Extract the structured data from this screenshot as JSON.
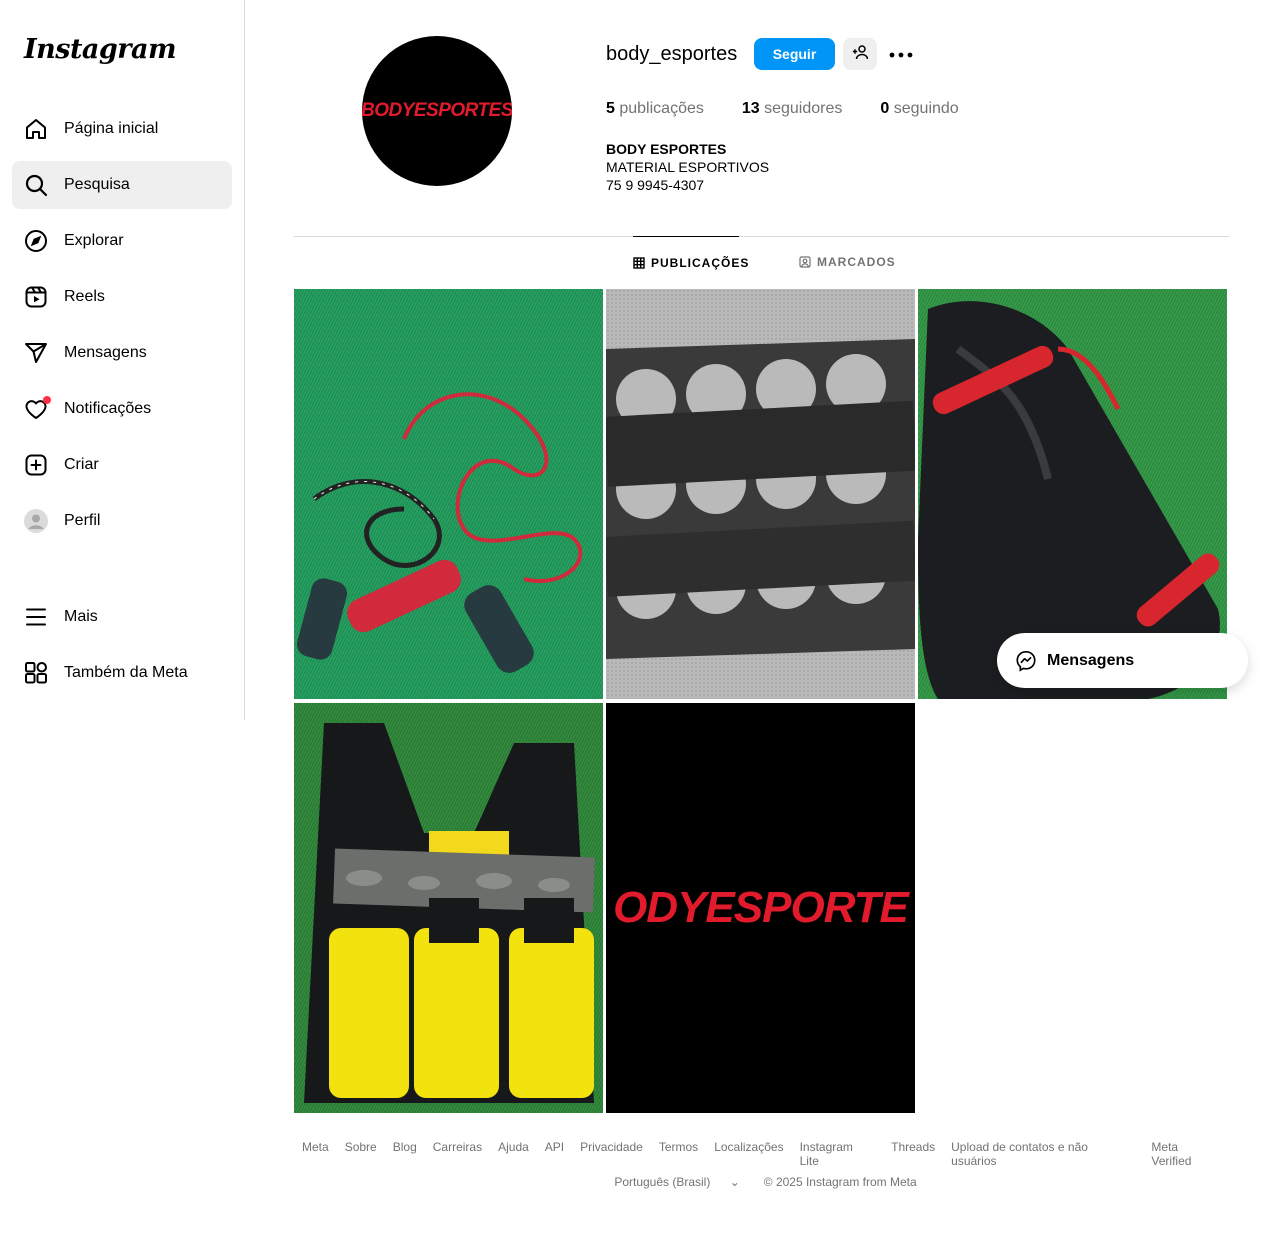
{
  "app": {
    "logo": "Instagram"
  },
  "sidebar": {
    "items": [
      {
        "label": "Página inicial",
        "icon": "home-icon"
      },
      {
        "label": "Pesquisa",
        "icon": "search-icon"
      },
      {
        "label": "Explorar",
        "icon": "compass-icon"
      },
      {
        "label": "Reels",
        "icon": "reels-icon"
      },
      {
        "label": "Mensagens",
        "icon": "send-icon"
      },
      {
        "label": "Notificações",
        "icon": "heart-icon"
      },
      {
        "label": "Criar",
        "icon": "plus-square-icon"
      },
      {
        "label": "Perfil",
        "icon": "avatar-icon"
      },
      {
        "label": "Mais",
        "icon": "menu-icon"
      },
      {
        "label": "Também da Meta",
        "icon": "meta-apps-icon"
      }
    ],
    "active": "Pesquisa"
  },
  "profile": {
    "avatar_text": "BODYESPORTES",
    "username": "body_esportes",
    "follow_label": "Seguir",
    "stats": {
      "posts_count": "5",
      "posts_label": "publicações",
      "followers_count": "13",
      "followers_label": "seguidores",
      "following_count": "0",
      "following_label": "seguindo"
    },
    "bio": {
      "name": "BODY ESPORTES",
      "line1": "MATERIAL ESPORTIVOS",
      "line2": "75 9 9945-4307"
    }
  },
  "tabs": [
    {
      "label": "PUBLICAÇÕES",
      "icon": "grid-icon",
      "active": true
    },
    {
      "label": "MARCADOS",
      "icon": "tagged-icon",
      "active": false
    }
  ],
  "posts": [
    {
      "subject": "jump-ropes"
    },
    {
      "subject": "weight-belt"
    },
    {
      "subject": "punching-bag"
    },
    {
      "subject": "weighted-vest"
    },
    {
      "subject": "logo",
      "text": "ODYESPORTE"
    }
  ],
  "messages_float": {
    "label": "Mensagens"
  },
  "footer": {
    "links": [
      "Meta",
      "Sobre",
      "Blog",
      "Carreiras",
      "Ajuda",
      "API",
      "Privacidade",
      "Termos",
      "Localizações",
      "Instagram Lite",
      "Threads",
      "Upload de contatos e não usuários",
      "Meta Verified"
    ],
    "language": "Português (Brasil)",
    "copyright": "© 2025 Instagram from Meta"
  },
  "colors": {
    "accent": "#0095f6",
    "brand_red": "#e21b2c",
    "notif": "#ff3040"
  }
}
